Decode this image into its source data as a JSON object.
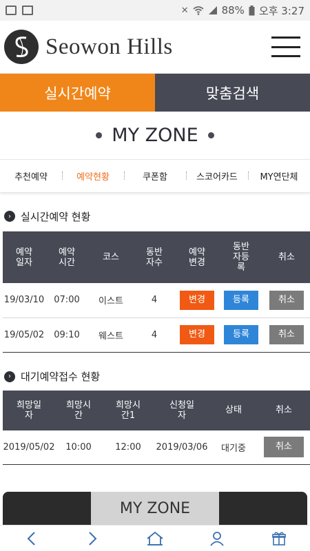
{
  "status_bar": {
    "battery": "88%",
    "time": "오후 3:27",
    "icons": [
      "mail-icon",
      "image-icon",
      "mute-icon",
      "wifi-icon",
      "signal-icon",
      "battery-icon"
    ]
  },
  "header": {
    "brand": "Seowon Hills",
    "logo_icon": "leaf-s-logo",
    "menu_icon": "hamburger-icon"
  },
  "tabs": [
    {
      "label": "실시간예약",
      "active": true
    },
    {
      "label": "맞춤검색",
      "active": false
    }
  ],
  "page_title": "MY ZONE",
  "subnav": [
    {
      "label": "추천예약",
      "active": false
    },
    {
      "label": "예약현황",
      "active": true
    },
    {
      "label": "쿠폰함",
      "active": false
    },
    {
      "label": "스코어카드",
      "active": false
    },
    {
      "label": "MY연단체",
      "active": false
    }
  ],
  "realtime": {
    "title": "실시간예약 현황",
    "headers": [
      "예약\n일자",
      "예약\n시간",
      "코스",
      "동반\n자수",
      "예약\n변경",
      "동반\n자등\n록",
      "취소"
    ],
    "rows": [
      {
        "date": "19/03/10",
        "time": "07:00",
        "course": "이스트",
        "companions": "4",
        "change": "변경",
        "register": "등록",
        "cancel": "취소"
      },
      {
        "date": "19/05/02",
        "time": "09:10",
        "course": "웨스트",
        "companions": "4",
        "change": "변경",
        "register": "등록",
        "cancel": "취소"
      }
    ]
  },
  "waiting": {
    "title": "대기예약접수 현황",
    "headers": [
      "희망일\n자",
      "희망시\n간",
      "희망시\n간1",
      "신청일\n자",
      "상태",
      "취소"
    ],
    "rows": [
      {
        "hope_date": "2019/05/02",
        "hope_time": "10:00",
        "hope_time1": "12:00",
        "apply_date": "2019/03/06",
        "status": "대기중",
        "cancel": "취소"
      }
    ]
  },
  "bottom_tab": "MY ZONE",
  "colors": {
    "accent_orange": "#f08619",
    "dark_tab": "#474955",
    "change_button": "#f05a14",
    "register_button": "#2f86d8",
    "cancel_button": "#7b7b7b"
  },
  "bottom_nav": [
    "back-icon",
    "forward-icon",
    "home-icon",
    "user-icon",
    "gift-icon"
  ]
}
